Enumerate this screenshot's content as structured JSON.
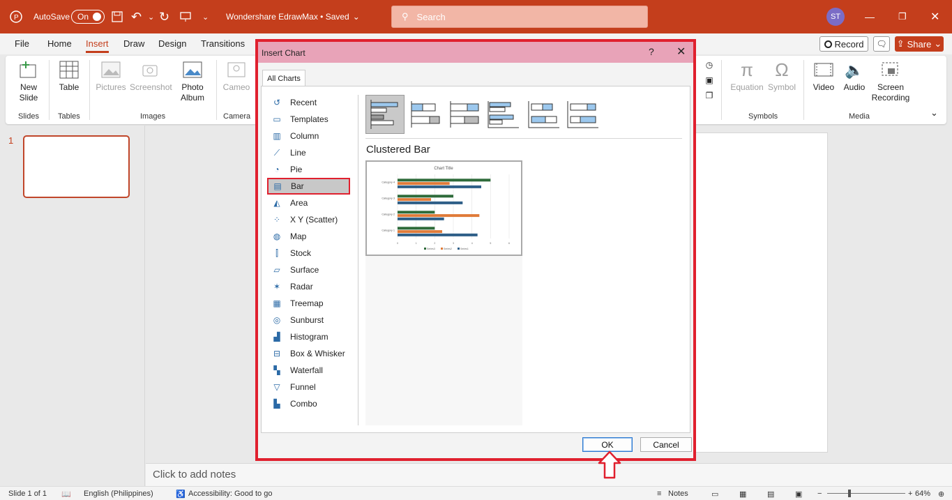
{
  "titlebar": {
    "autosave_label": "AutoSave",
    "autosave_state": "On",
    "doc_title": "Wondershare EdrawMax • Saved",
    "search_placeholder": "Search",
    "user_initials": "ST",
    "color": "#c43e1c"
  },
  "menu": {
    "tabs": [
      "File",
      "Home",
      "Insert",
      "Draw",
      "Design",
      "Transitions"
    ],
    "active": "Insert",
    "record_label": "Record",
    "share_label": "Share"
  },
  "ribbon": {
    "buttons": {
      "new_slide": "New Slide",
      "table": "Table",
      "pictures": "Pictures",
      "screenshot": "Screenshot",
      "photo_album": "Photo Album",
      "cameo": "Cameo",
      "equation": "Equation",
      "symbol": "Symbol",
      "video": "Video",
      "audio": "Audio",
      "screen_recording": "Screen Recording"
    },
    "groups": {
      "slides": "Slides",
      "tables": "Tables",
      "images": "Images",
      "camera": "Camera",
      "symbols": "Symbols",
      "media": "Media"
    }
  },
  "slides_pane": {
    "slide_number": "1"
  },
  "notes": {
    "placeholder": "Click to add notes"
  },
  "statusbar": {
    "slide_info": "Slide 1 of 1",
    "language": "English (Philippines)",
    "accessibility": "Accessibility: Good to go",
    "notes_label": "Notes",
    "zoom": "64%"
  },
  "dialog": {
    "title": "Insert Chart",
    "help": "?",
    "tab": "All Charts",
    "selected_type": "Bar",
    "types": [
      "Recent",
      "Templates",
      "Column",
      "Line",
      "Pie",
      "Bar",
      "Area",
      "X Y (Scatter)",
      "Map",
      "Stock",
      "Surface",
      "Radar",
      "Treemap",
      "Sunburst",
      "Histogram",
      "Box & Whisker",
      "Waterfall",
      "Funnel",
      "Combo"
    ],
    "subtype_title": "Clustered Bar",
    "ok_label": "OK",
    "cancel_label": "Cancel",
    "accent": "#e0202e",
    "preview": {
      "title": "Chart Title",
      "categories": [
        "Category 4",
        "Category 3",
        "Category 2",
        "Category 1"
      ],
      "axis_ticks": [
        "0",
        "1",
        "2",
        "3",
        "4",
        "5",
        "6"
      ],
      "legend": [
        "Series3",
        "Series2",
        "Series1"
      ]
    }
  },
  "chart_data": {
    "type": "bar",
    "title": "Chart Title",
    "categories": [
      "Category 1",
      "Category 2",
      "Category 3",
      "Category 4"
    ],
    "series": [
      {
        "name": "Series1",
        "values": [
          4.3,
          2.5,
          3.5,
          4.5
        ],
        "color": "#2f5f88"
      },
      {
        "name": "Series2",
        "values": [
          2.4,
          4.4,
          1.8,
          2.8
        ],
        "color": "#e07b39"
      },
      {
        "name": "Series3",
        "values": [
          2.0,
          2.0,
          3.0,
          5.0
        ],
        "color": "#2e6b3a"
      }
    ],
    "xlim": [
      0,
      6
    ],
    "legend": "bottom"
  }
}
